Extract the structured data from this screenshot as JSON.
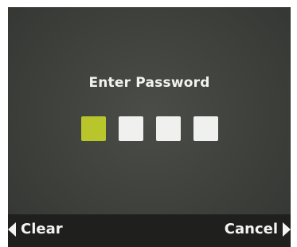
{
  "screen": {
    "title": "Enter Password",
    "pin_entry": {
      "length": 4,
      "active_index": 0
    }
  },
  "softkeys": {
    "left_label": "Clear",
    "right_label": "Cancel",
    "left_icon": "triangle-left-icon",
    "right_icon": "triangle-right-icon"
  },
  "colors": {
    "screen_background": "#3d403b",
    "pin_box": "#f0f1ee",
    "pin_box_active": "#b8c62b",
    "softkey_bar": "#1f201e",
    "text": "#f2f2ee"
  }
}
